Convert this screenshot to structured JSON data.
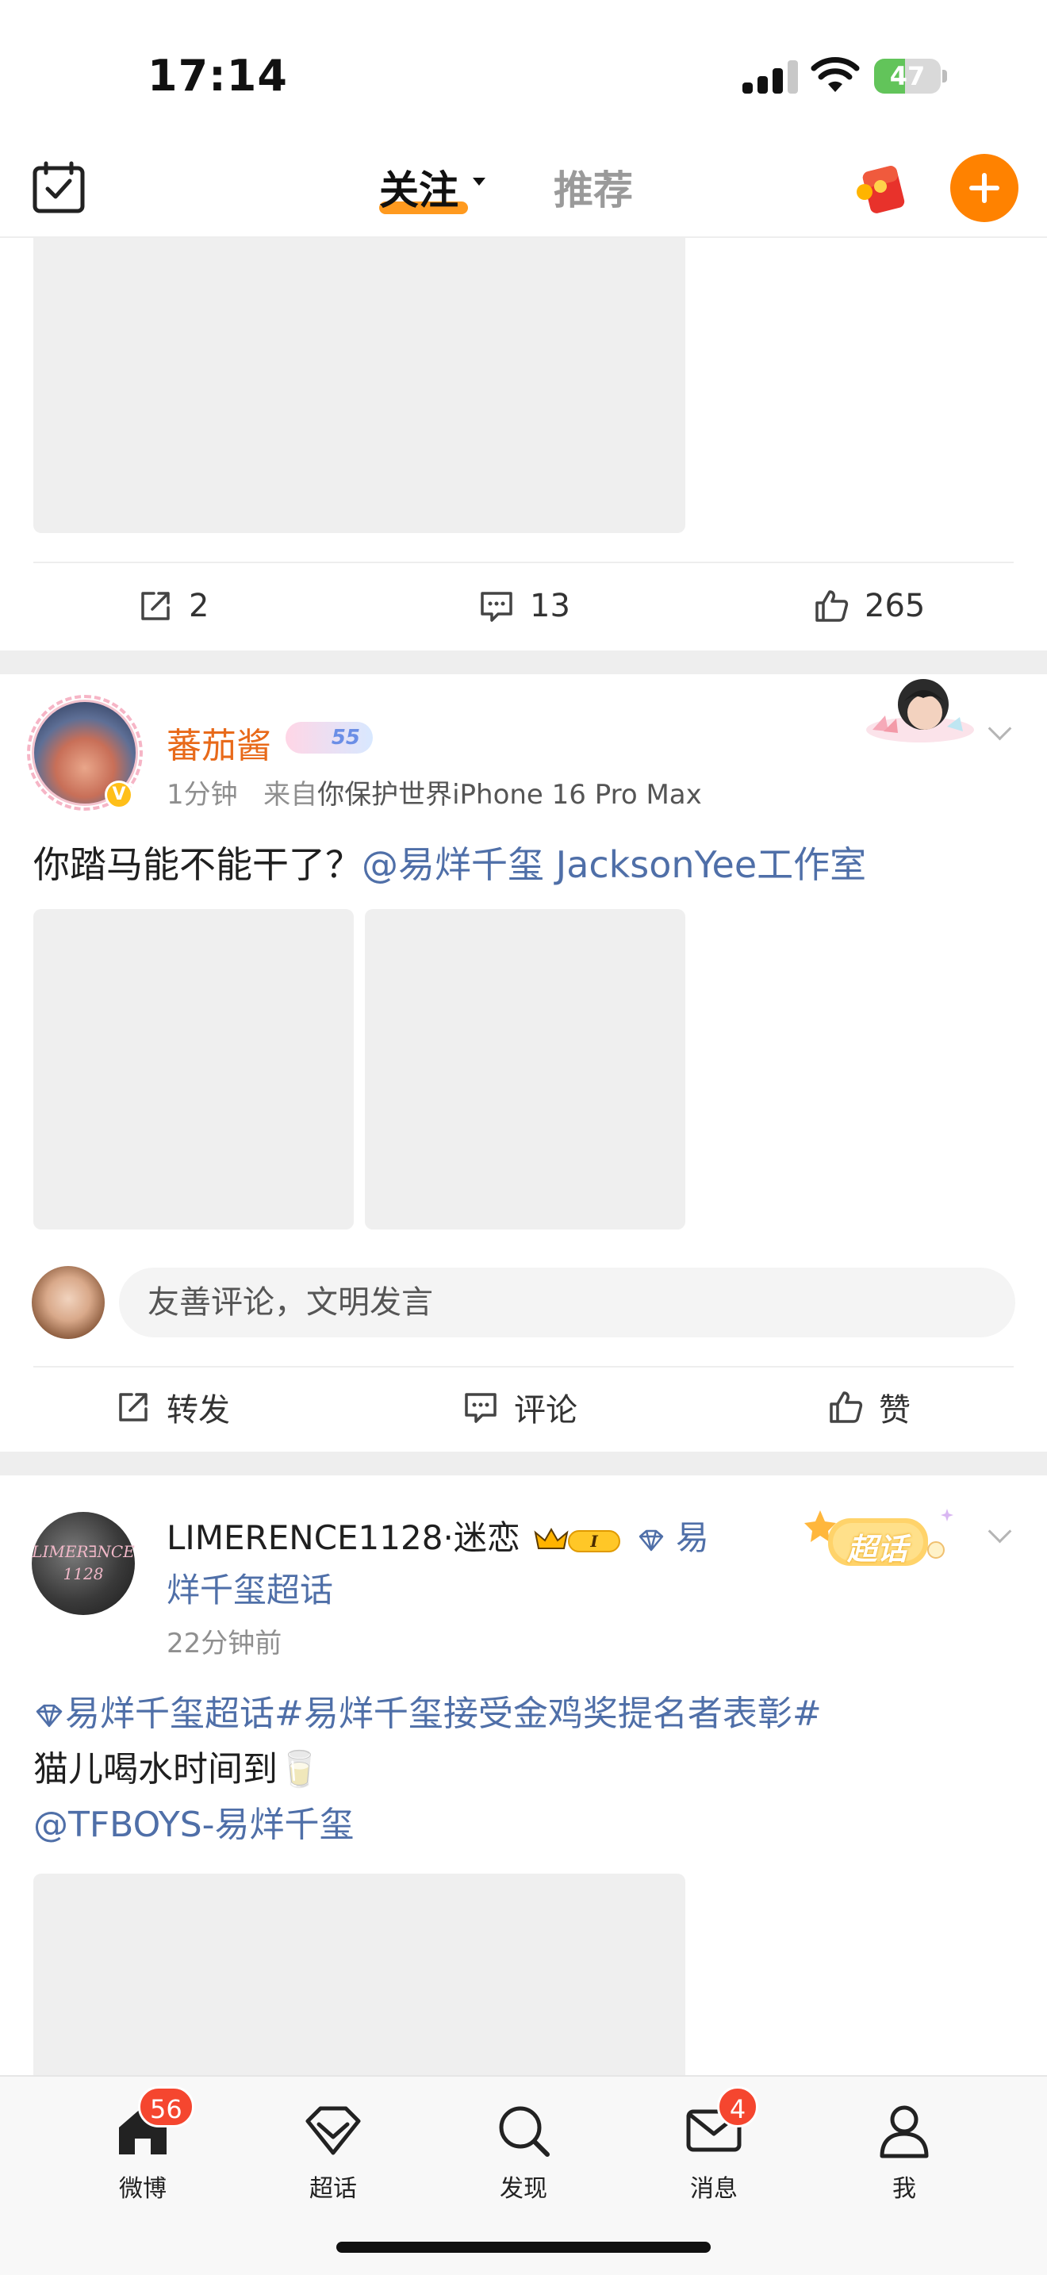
{
  "status_bar": {
    "time": "17:14",
    "battery": "47",
    "battery_fraction": 0.47
  },
  "nav": {
    "tab_follow": "关注",
    "tab_recommend": "推荐"
  },
  "post1": {
    "repost_count": "2",
    "comment_count": "13",
    "like_count": "265"
  },
  "post2": {
    "author": "蕃茄酱",
    "level": "55",
    "time": "1分钟",
    "source_prefix": "来自",
    "source": "你保护世界iPhone 16 Pro Max",
    "text": "你踏马能不能干了？",
    "mention": "@易烊千玺 JacksonYee工作室",
    "comment_placeholder": "友善评论，文明发言",
    "action_repost": "转发",
    "action_comment": "评论",
    "action_like": "赞"
  },
  "post3": {
    "avatar_text_line1": "LIMER∃NCE",
    "avatar_text_line2": "1128",
    "author": "LIMERENCE1128",
    "separator": "·",
    "fan_title": "迷恋",
    "vip_level": "I",
    "topic_line1": "易",
    "topic_line2": "烊千玺超话",
    "time": "22分钟前",
    "sticker": "超话",
    "body_topic": "易烊千玺超话#易烊千玺接受金鸡奖提名者表彰#",
    "body_text": "猫儿喝水时间到🥛",
    "body_mention": "@TFBOYS-易烊千玺"
  },
  "tab_bar": {
    "home": "微博",
    "home_badge": "56",
    "supertopic": "超话",
    "discover": "发现",
    "messages": "消息",
    "messages_badge": "4",
    "me": "我"
  },
  "colors": {
    "accent": "#ff8200",
    "link": "#4f6fa8",
    "username": "#e86a1a",
    "badge": "#f5462f"
  }
}
